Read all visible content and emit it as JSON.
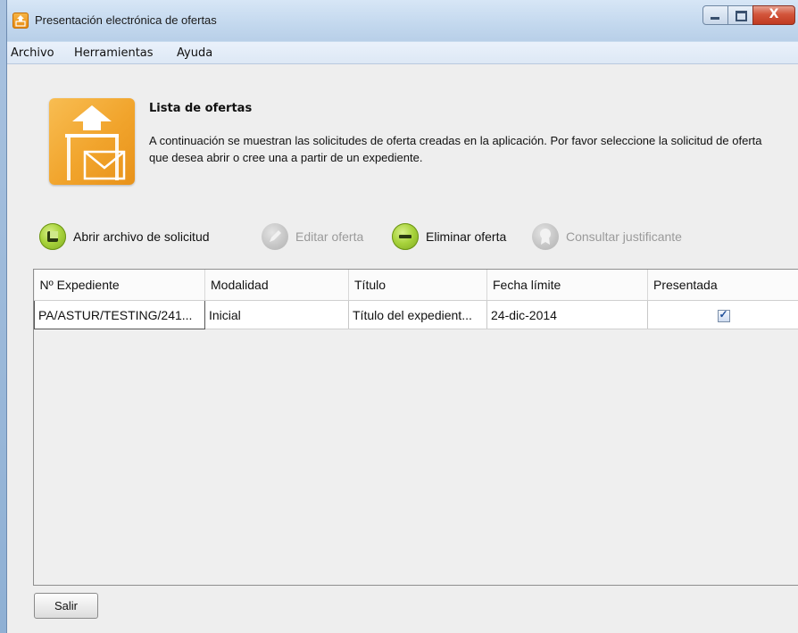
{
  "window": {
    "title": "Presentación electrónica de ofertas",
    "close_glyph": "X"
  },
  "menu": [
    "Archivo",
    "Herramientas",
    "Ayuda"
  ],
  "header": {
    "title": "Lista de ofertas",
    "description": "A continuación se muestran las solicitudes de oferta creadas en la aplicación. Por favor seleccione la solicitud de oferta que desea abrir o cree una a partir de un expediente."
  },
  "toolbar": {
    "open": "Abrir archivo de solicitud",
    "edit": "Editar oferta",
    "delete": "Eliminar oferta",
    "consult": "Consultar justificante"
  },
  "table": {
    "columns": [
      "Nº Expediente",
      "Modalidad",
      "Título",
      "Fecha límite",
      "Presentada"
    ],
    "rows": [
      {
        "expediente": "PA/ASTUR/TESTING/241...",
        "modalidad": "Inicial",
        "titulo": "Título del expedient...",
        "fecha": "24-dic-2014",
        "presentada": true
      }
    ]
  },
  "footer": {
    "exit": "Salir"
  },
  "colors": {
    "accent_orange": "#f1a42c",
    "green_button": "#a8d33c",
    "disabled_gray": "#c6c6c6"
  }
}
